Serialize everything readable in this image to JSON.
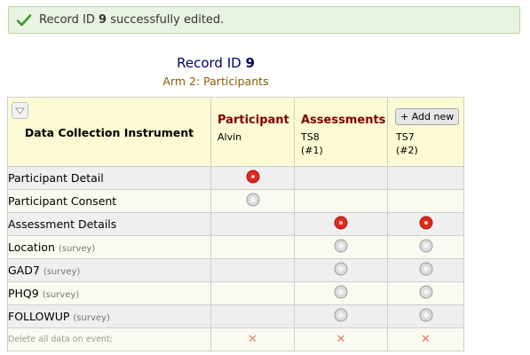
{
  "alert": {
    "prefix": "Record ID",
    "record_id": "9",
    "suffix": "successfully edited."
  },
  "record": {
    "title_prefix": "Record ID",
    "id": "9",
    "arm": "Arm 2: Participants"
  },
  "table": {
    "instrument_header": "Data Collection Instrument",
    "events": [
      {
        "name": "Participant",
        "sub": "Alvin",
        "sub2": ""
      },
      {
        "name": "Assessments",
        "sub": "TS8",
        "sub2": "(#1)"
      },
      {
        "name": "",
        "add_new": "+ Add new",
        "sub": "TS7",
        "sub2": "(#2)"
      }
    ],
    "rows": [
      {
        "name": "Participant Detail",
        "survey": "",
        "status": [
          "red",
          "none",
          "none"
        ]
      },
      {
        "name": "Participant Consent",
        "survey": "",
        "status": [
          "gray",
          "none",
          "none"
        ]
      },
      {
        "name": "Assessment Details",
        "survey": "",
        "status": [
          "none",
          "red",
          "red"
        ]
      },
      {
        "name": "Location",
        "survey": "(survey)",
        "status": [
          "none",
          "gray",
          "gray"
        ]
      },
      {
        "name": "GAD7",
        "survey": "(survey)",
        "status": [
          "none",
          "gray",
          "gray"
        ]
      },
      {
        "name": "PHQ9",
        "survey": "(survey)",
        "status": [
          "none",
          "gray",
          "gray"
        ]
      },
      {
        "name": "FOLLOWUP",
        "survey": "(survey)",
        "status": [
          "none",
          "gray",
          "gray"
        ]
      }
    ],
    "delete_label": "Delete all data on event:",
    "delete_mark": "✕"
  },
  "colors": {
    "status_incomplete": "#e0281e",
    "status_empty": "#c8c8c8",
    "event_title": "#800000",
    "header_bg": "#fdfbd3"
  }
}
